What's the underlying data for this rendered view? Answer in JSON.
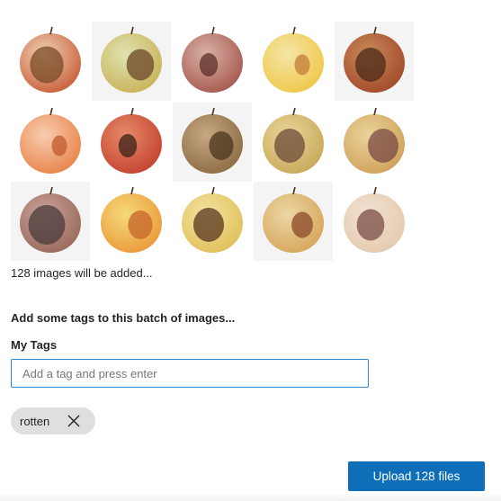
{
  "thumbnails": [
    {
      "row": 0,
      "col": 0,
      "icon": "rotten-apple-image"
    },
    {
      "row": 0,
      "col": 1,
      "icon": "rotten-apple-image"
    },
    {
      "row": 0,
      "col": 2,
      "icon": "rotten-apple-image"
    },
    {
      "row": 0,
      "col": 3,
      "icon": "rotten-apple-image"
    },
    {
      "row": 0,
      "col": 4,
      "icon": "rotten-apple-image"
    },
    {
      "row": 1,
      "col": 0,
      "icon": "rotten-apple-image"
    },
    {
      "row": 1,
      "col": 1,
      "icon": "rotten-apple-image"
    },
    {
      "row": 1,
      "col": 2,
      "icon": "rotten-apple-image"
    },
    {
      "row": 1,
      "col": 3,
      "icon": "rotten-apple-image"
    },
    {
      "row": 1,
      "col": 4,
      "icon": "rotten-apple-image"
    },
    {
      "row": 2,
      "col": 0,
      "icon": "rotten-apple-image"
    },
    {
      "row": 2,
      "col": 1,
      "icon": "rotten-apple-image"
    },
    {
      "row": 2,
      "col": 2,
      "icon": "rotten-apple-image"
    },
    {
      "row": 2,
      "col": 3,
      "icon": "rotten-apple-image"
    },
    {
      "row": 2,
      "col": 4,
      "icon": "rotten-apple-image"
    }
  ],
  "status": {
    "count_text": "128 images will be added..."
  },
  "tags": {
    "heading": "Add some tags to this batch of images...",
    "label": "My Tags",
    "input_value": "",
    "input_placeholder": "Add a tag and press enter",
    "chips": [
      {
        "label": "rotten",
        "remove_icon": "close-icon"
      }
    ]
  },
  "actions": {
    "upload_label": "Upload 128 files"
  },
  "colors": {
    "accent": "#0e6eb8",
    "input_border": "#2f86d7",
    "chip_background": "#e1dfdd"
  }
}
